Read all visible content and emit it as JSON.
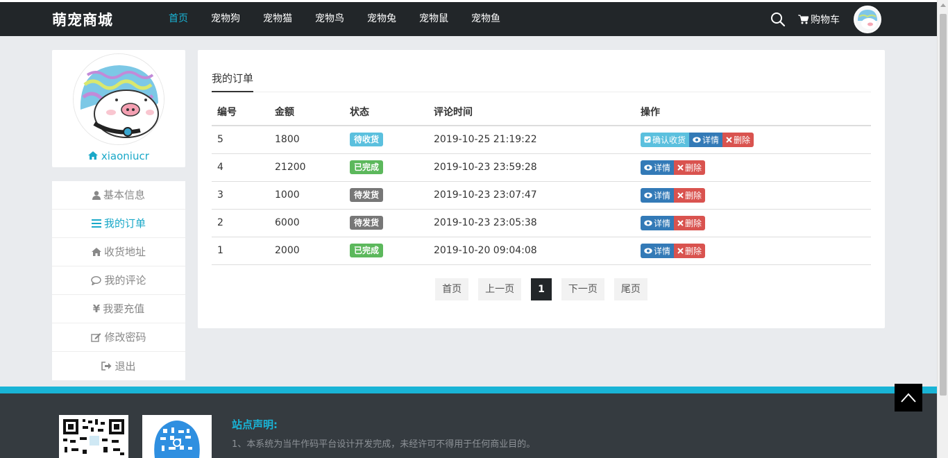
{
  "header": {
    "brand": "萌宠商城",
    "nav": [
      {
        "label": "首页",
        "active": true
      },
      {
        "label": "宠物狗",
        "active": false
      },
      {
        "label": "宠物猫",
        "active": false
      },
      {
        "label": "宠物鸟",
        "active": false
      },
      {
        "label": "宠物兔",
        "active": false
      },
      {
        "label": "宠物鼠",
        "active": false
      },
      {
        "label": "宠物鱼",
        "active": false
      }
    ],
    "search_icon": "search-icon",
    "cart_label": "购物车",
    "cart_icon": "shopping-cart-icon"
  },
  "profile": {
    "username": "xiaoniucr",
    "username_icon": "home-icon"
  },
  "sidebar": {
    "items": [
      {
        "label": "基本信息",
        "icon": "user-icon"
      },
      {
        "label": "我的订单",
        "icon": "list-icon"
      },
      {
        "label": "收货地址",
        "icon": "home-icon"
      },
      {
        "label": "我的评论",
        "icon": "comment-icon"
      },
      {
        "label": "我要充值",
        "icon": "yen-icon"
      },
      {
        "label": "修改密码",
        "icon": "edit-icon"
      },
      {
        "label": "退出",
        "icon": "sign-out-icon"
      }
    ],
    "active_index": 1
  },
  "orders": {
    "tab_title": "我的订单",
    "columns": [
      "编号",
      "金额",
      "状态",
      "评论时间",
      "操作"
    ],
    "rows": [
      {
        "id": "5",
        "amount": "1800",
        "status": "待收货",
        "status_style": "info",
        "time": "2019-10-25 21:19:22",
        "actions": [
          "确认收货",
          "详情",
          "删除"
        ]
      },
      {
        "id": "4",
        "amount": "21200",
        "status": "已完成",
        "status_style": "success",
        "time": "2019-10-23 23:59:28",
        "actions": [
          "详情",
          "删除"
        ]
      },
      {
        "id": "3",
        "amount": "1000",
        "status": "待发货",
        "status_style": "default",
        "time": "2019-10-23 23:07:47",
        "actions": [
          "详情",
          "删除"
        ]
      },
      {
        "id": "2",
        "amount": "6000",
        "status": "待发货",
        "status_style": "default",
        "time": "2019-10-23 23:05:38",
        "actions": [
          "详情",
          "删除"
        ]
      },
      {
        "id": "1",
        "amount": "2000",
        "status": "已完成",
        "status_style": "success",
        "time": "2019-10-20 09:04:08",
        "actions": [
          "详情",
          "删除"
        ]
      }
    ],
    "colors": {
      "info": "#5bc0de",
      "success": "#5cb85c",
      "default": "#777777",
      "primary": "#337ab7",
      "danger": "#d9534f"
    }
  },
  "pager": {
    "first": "首页",
    "prev": "上一页",
    "current": "1",
    "next": "下一页",
    "last": "尾页"
  },
  "footer": {
    "declaration_title": "站点声明:",
    "declaration_text": "1、本系统为当牛作码平台设计开发完成，未经许可不得用于任何商业目的。"
  },
  "colors": {
    "accent": "#19b4d6",
    "header_bg": "#222629",
    "footer_bg": "#353b40"
  }
}
